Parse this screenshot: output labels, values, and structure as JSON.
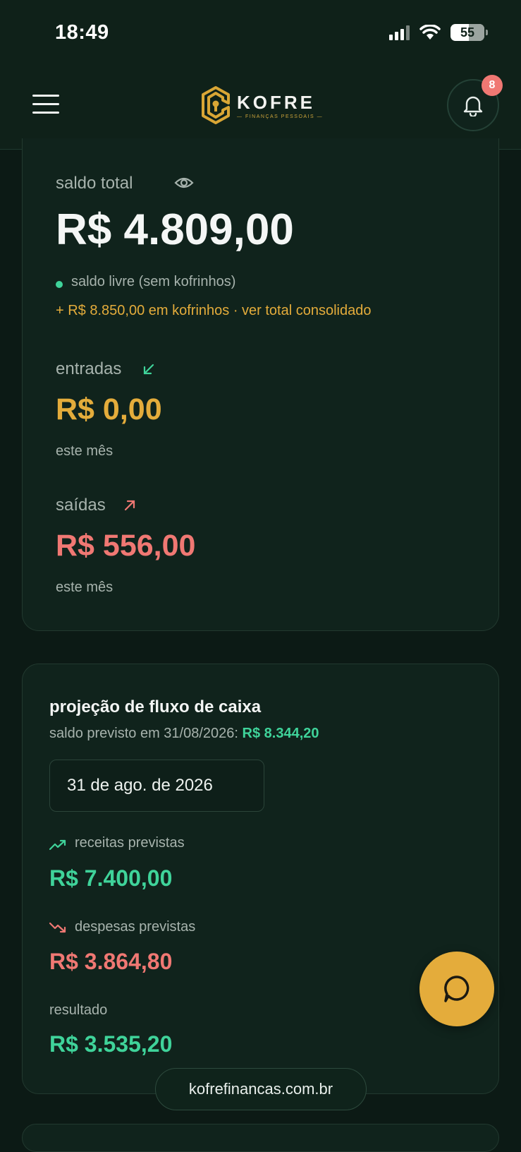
{
  "status_bar": {
    "time": "18:49",
    "battery": "55"
  },
  "header": {
    "brand": "KOFRE",
    "brand_subtitle": "— FINANÇAS PESSOAIS —",
    "notification_count": "8"
  },
  "balance_card": {
    "total_label": "saldo total",
    "total_value": "R$ 4.809,00",
    "free_note": "saldo livre (sem kofrinhos)",
    "piggy_note": "+ R$ 8.850,00 em kofrinhos · ver total consolidado",
    "income_label": "entradas",
    "income_value": "R$ 0,00",
    "income_period": "este mês",
    "expense_label": "saídas",
    "expense_value": "R$ 556,00",
    "expense_period": "este mês"
  },
  "projection_card": {
    "title": "projeção de fluxo de caixa",
    "forecast_prefix": "saldo previsto em 31/08/2026:",
    "forecast_value": "R$ 8.344,20",
    "date_field_value": "31 de ago. de 2026",
    "income_label": "receitas previstas",
    "income_value": "R$ 7.400,00",
    "expense_label": "despesas previstas",
    "expense_value": "R$ 3.864,80",
    "result_label": "resultado",
    "result_value": "R$ 3.535,20"
  },
  "footer": {
    "url": "kofrefinancas.com.br"
  },
  "colors": {
    "background": "#0c1a15",
    "card": "#10231c",
    "gold": "#e4ac3b",
    "green": "#3fd39a",
    "red": "#f07873",
    "muted": "#a7b3ad"
  },
  "icons": [
    "menu-icon",
    "logo-icon",
    "bell-icon",
    "eye-icon",
    "arrow-down-left-icon",
    "arrow-up-right-icon",
    "trend-up-icon",
    "trend-down-icon",
    "chat-icon"
  ]
}
